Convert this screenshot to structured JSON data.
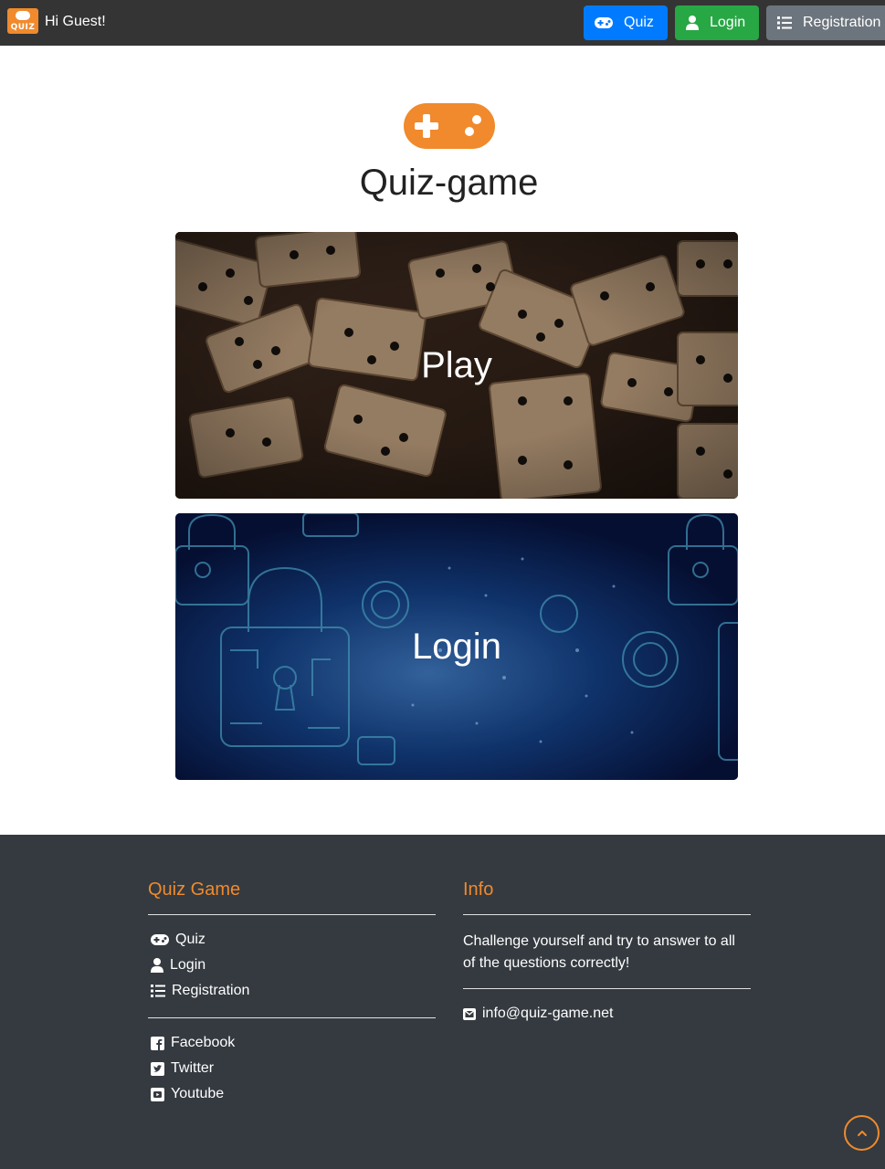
{
  "navbar": {
    "logo_text": "QUIZ",
    "greeting": "Hi Guest!",
    "buttons": {
      "quiz": "Quiz",
      "login": "Login",
      "registration": "Registration"
    }
  },
  "hero": {
    "icon": "gamepad-icon",
    "title": "Quiz-game"
  },
  "cards": {
    "play": "Play",
    "login": "Login"
  },
  "footer": {
    "col1": {
      "heading": "Quiz Game",
      "nav": {
        "quiz": "Quiz",
        "login": "Login",
        "registration": "Registration"
      },
      "social": {
        "facebook": "Facebook",
        "twitter": "Twitter",
        "youtube": "Youtube"
      }
    },
    "col2": {
      "heading": "Info",
      "text": "Challenge yourself and try to answer to all of the questions correctly!",
      "email": "info@quiz-game.net"
    }
  },
  "colors": {
    "accent": "#f08a2c",
    "quiz_button": "#007bff",
    "login_button": "#28a745",
    "registration_button": "#6c757d",
    "navbar": "#343434",
    "footer": "#343a40"
  }
}
